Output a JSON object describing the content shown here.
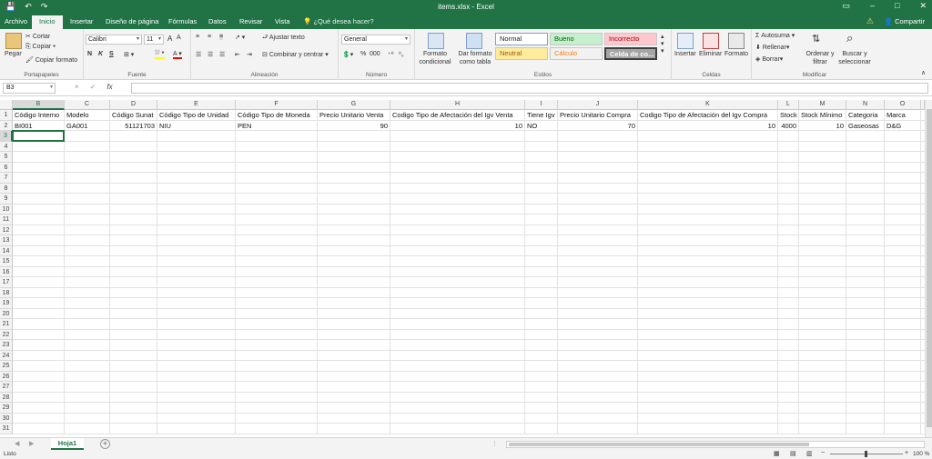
{
  "window": {
    "title": "items.xlsx - Excel"
  },
  "tabs": [
    "Archivo",
    "Inicio",
    "Insertar",
    "Diseño de página",
    "Fórmulas",
    "Datos",
    "Revisar",
    "Vista"
  ],
  "tell_me": "¿Qué desea hacer?",
  "share": "Compartir",
  "ribbon": {
    "clipboard": {
      "label": "Portapapeles",
      "paste": "Pegar",
      "cut": "Cortar",
      "copy": "Copiar",
      "format_painter": "Copiar formato"
    },
    "font": {
      "label": "Fuente",
      "name": "Calibri",
      "size": "11",
      "bold": "N",
      "italic": "K",
      "underline": "S"
    },
    "alignment": {
      "label": "Alineación",
      "wrap": "Ajustar texto",
      "merge": "Combinar y centrar"
    },
    "number": {
      "label": "Número",
      "format": "General",
      "percent": "%",
      "thousands": "000"
    },
    "styles": {
      "label": "Estilos",
      "conditional": "Formato condicional",
      "as_table": "Dar formato como tabla",
      "cells": [
        {
          "name": "Normal",
          "bg": "#ffffff",
          "fg": "#222222"
        },
        {
          "name": "Bueno",
          "bg": "#c6efce",
          "fg": "#006100"
        },
        {
          "name": "Incorrecto",
          "bg": "#ffc7ce",
          "fg": "#9c0006"
        },
        {
          "name": "Neutral",
          "bg": "#ffeb9c",
          "fg": "#9c5700"
        },
        {
          "name": "Cálculo",
          "bg": "#f2f2f2",
          "fg": "#fa7d00"
        },
        {
          "name": "Celda de co...",
          "bg": "#a5a5a5",
          "fg": "#ffffff"
        }
      ]
    },
    "cells": {
      "label": "Celdas",
      "insert": "Insertar",
      "delete": "Eliminar",
      "format": "Formato"
    },
    "editing": {
      "label": "Modificar",
      "autosum": "Autosuma",
      "fill": "Rellenar",
      "clear": "Borrar",
      "sort": "Ordenar y filtrar",
      "find": "Buscar y seleccionar"
    }
  },
  "formula_bar": {
    "name_box": "B3",
    "cancel": "×",
    "enter": "✓",
    "fx": "fx",
    "value": ""
  },
  "sheet": {
    "columns": [
      "B",
      "C",
      "D",
      "E",
      "F",
      "G",
      "H",
      "I",
      "J",
      "K",
      "L",
      "M",
      "N",
      "O"
    ],
    "selected_column": "B",
    "selected_row": 3,
    "header_row": [
      "Código Interno",
      "Modelo",
      "Código Sunat",
      "Código Tipo de Unidad",
      "Código Tipo de Moneda",
      "Precio Unitario Venta",
      "Codigo Tipo de Afectación del Igv Venta",
      "Tiene Igv",
      "Precio Unitario Compra",
      "Codigo Tipo de Afectación del Igv Compra",
      "Stock",
      "Stock Mínimo",
      "Categoria",
      "Marca"
    ],
    "data_row": [
      "BI001",
      "GA001",
      "51121703",
      "NIU",
      "PEN",
      "90",
      "10",
      "NO",
      "70",
      "10",
      "4000",
      "10",
      "Gaseosas",
      "D&G"
    ],
    "numeric_columns": [
      "D",
      "G",
      "H",
      "J",
      "K",
      "L",
      "M"
    ],
    "row_count": 31
  },
  "sheet_tabs": {
    "active": "Hoja1",
    "add": "+"
  },
  "status": {
    "left": "Listo",
    "zoom": "100 %"
  }
}
